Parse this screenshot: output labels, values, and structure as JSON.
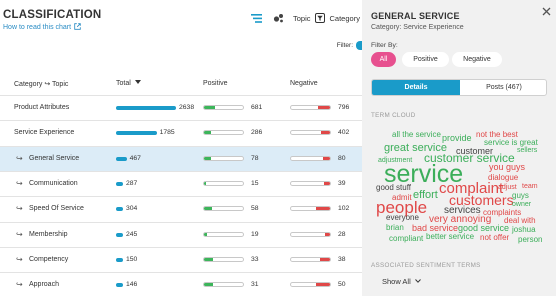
{
  "header": {
    "title": "CLASSIFICATION",
    "howto": "How to read this chart",
    "topic_label": "Topic",
    "category_label": "Category",
    "filter_label": "Filter:"
  },
  "table": {
    "columns": {
      "name": "Category ↪ Topic",
      "total": "Total",
      "positive": "Positive",
      "negative": "Negative"
    },
    "rows": [
      {
        "name": "Product Attributes",
        "sub": false,
        "selected": false,
        "total": 2638,
        "positive": 681,
        "negative": 796
      },
      {
        "name": "Service Experience",
        "sub": false,
        "selected": false,
        "total": 1785,
        "positive": 286,
        "negative": 402
      },
      {
        "name": "General Service",
        "sub": true,
        "selected": true,
        "total": 467,
        "positive": 78,
        "negative": 80
      },
      {
        "name": "Communication",
        "sub": true,
        "selected": false,
        "total": 287,
        "positive": 15,
        "negative": 39
      },
      {
        "name": "Speed Of Service",
        "sub": true,
        "selected": false,
        "total": 304,
        "positive": 58,
        "negative": 102
      },
      {
        "name": "Membership",
        "sub": true,
        "selected": false,
        "total": 245,
        "positive": 19,
        "negative": 28
      },
      {
        "name": "Competency",
        "sub": true,
        "selected": false,
        "total": 150,
        "positive": 33,
        "negative": 38
      },
      {
        "name": "Approach",
        "sub": true,
        "selected": false,
        "total": 146,
        "positive": 31,
        "negative": 50
      }
    ],
    "max_total": 2638
  },
  "panel": {
    "title": "GENERAL SERVICE",
    "subtitle": "Category: Service Experience",
    "filter_by": "Filter By:",
    "filters": [
      "All",
      "Positive",
      "Negative"
    ],
    "active_filter": "All",
    "tabs": {
      "details": "Details",
      "posts": "Posts (467)"
    },
    "term_cloud_title": "TERM CLOUD",
    "assoc_title": "ASSOCIATED SENTIMENT TERMS",
    "show_all": "Show All"
  },
  "term_cloud": [
    {
      "text": "all the service",
      "tone": "g"
    },
    {
      "text": "provide",
      "tone": "g"
    },
    {
      "text": "not the best",
      "tone": "r"
    },
    {
      "text": "great service",
      "tone": "g"
    },
    {
      "text": "customer",
      "tone": "d"
    },
    {
      "text": "service is great",
      "tone": "g"
    },
    {
      "text": "adjustment",
      "tone": "g"
    },
    {
      "text": "customer service",
      "tone": "g"
    },
    {
      "text": "sellers",
      "tone": "g"
    },
    {
      "text": "you guys",
      "tone": "r"
    },
    {
      "text": "service",
      "tone": "g"
    },
    {
      "text": "dialogue",
      "tone": "r"
    },
    {
      "text": "good stuff",
      "tone": "d"
    },
    {
      "text": "complaint",
      "tone": "r"
    },
    {
      "text": "adjust",
      "tone": "r"
    },
    {
      "text": "team",
      "tone": "r"
    },
    {
      "text": "admit",
      "tone": "r"
    },
    {
      "text": "effort",
      "tone": "g"
    },
    {
      "text": "customers",
      "tone": "r"
    },
    {
      "text": "guys",
      "tone": "g"
    },
    {
      "text": "people",
      "tone": "r"
    },
    {
      "text": "owner",
      "tone": "g"
    },
    {
      "text": "services",
      "tone": "d"
    },
    {
      "text": "complaints",
      "tone": "r"
    },
    {
      "text": "everyone",
      "tone": "d"
    },
    {
      "text": "very annoying",
      "tone": "r"
    },
    {
      "text": "deal with",
      "tone": "r"
    },
    {
      "text": "brian",
      "tone": "g"
    },
    {
      "text": "bad service",
      "tone": "r"
    },
    {
      "text": "good service",
      "tone": "g"
    },
    {
      "text": "joshua",
      "tone": "g"
    },
    {
      "text": "compliant",
      "tone": "g"
    },
    {
      "text": "better service",
      "tone": "g"
    },
    {
      "text": "not offer",
      "tone": "r"
    },
    {
      "text": "person",
      "tone": "g"
    }
  ],
  "colors": {
    "accent": "#1a9bc9",
    "positive": "#3cb55a",
    "negative": "#e04848",
    "filter_active": "#e7508f",
    "selected_row": "#dcecf7",
    "panel_bg": "#f1f1f1"
  },
  "icons": {
    "list_view": "bars-icon",
    "cluster_view": "bubbles-icon",
    "topic": "funnel-icon",
    "category": "funnel-icon",
    "external": "external-link-icon",
    "close": "close-icon",
    "subrow": "subrow-arrow-icon",
    "sort": "caret-down-icon",
    "show_all": "chevron-down-icon"
  }
}
